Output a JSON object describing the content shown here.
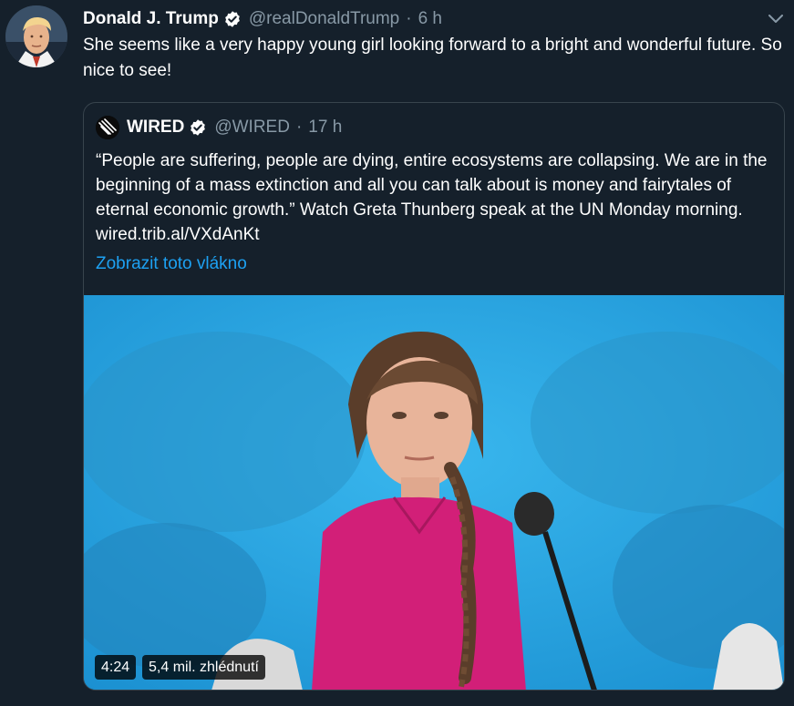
{
  "tweet": {
    "author_name": "Donald J. Trump",
    "handle": "@realDonaldTrump",
    "separator": "·",
    "time": "6 h",
    "text": "She seems like a very happy young girl looking forward to a bright and wonderful future. So nice to see!"
  },
  "quoted": {
    "author_name": "WIRED",
    "handle": "@WIRED",
    "separator": "·",
    "time": "17 h",
    "text": "“People are suffering, people are dying, entire ecosystems are collapsing. We are in the beginning of a mass extinction and all you can talk about is money and fairytales of eternal economic growth.” Watch Greta Thunberg speak at the UN Monday morning. wired.trib.al/VXdAnKt",
    "thread_link": "Zobrazit toto vlákno",
    "video": {
      "duration": "4:24",
      "views": "5,4 mil. zhlédnutí"
    }
  },
  "colors": {
    "background": "#15202b",
    "muted_text": "#8899a6",
    "link": "#1da1f2",
    "border": "#38444d"
  },
  "icons": {
    "verified": "verified-badge-icon",
    "caret": "chevron-down-icon",
    "wired_logo": "wired-logo-icon"
  }
}
